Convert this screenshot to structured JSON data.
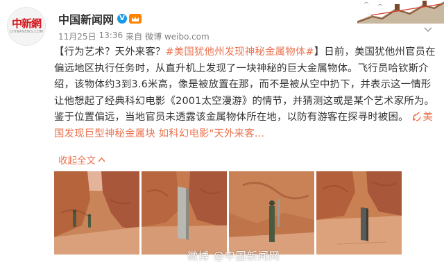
{
  "author": {
    "avatar_text": "中新網",
    "avatar_subtext": "CHINANEWS.COM",
    "name": "中国新闻网",
    "verified_badge": "V"
  },
  "meta": {
    "date": "11月25日",
    "time": "13:36",
    "source_prefix": "来自",
    "source": "微博 weibo.com"
  },
  "post": {
    "intro": "【行为艺术？天外来客？",
    "hashtag": "#美国犹他州发现神秘金属物体#",
    "body": "】日前，美国犹他州官员在偏远地区执行任务时，从直升机上发现了一块神秘的巨大金属物体。飞行员哈钦斯介绍，该物体约3到3.6米高，像是被放置在那，而不是被从空中扔下，并表示这一情形让他想起了经典科幻电影《2001太空漫游》的情节，并猜测这或是某个艺术家所为。鉴于位置偏远，当地官员未透露该金属物体所在地，以防有游客在探寻时被困。",
    "link_text": "美国发现巨型神秘金属块 如科幻电影\"天外来客..."
  },
  "actions": {
    "collapse_label": "收起全文",
    "collapse_icon": "chevron-up-icon"
  },
  "photos": [
    {
      "name": "photo-1"
    },
    {
      "name": "photo-2"
    },
    {
      "name": "photo-3"
    },
    {
      "name": "photo-4"
    }
  ],
  "watermark": "微博 @中国新闻网",
  "colors": {
    "accent": "#eb7350",
    "verified": "#1a9ae5",
    "vip": "#ff8200",
    "brand_red": "#d3141a"
  }
}
